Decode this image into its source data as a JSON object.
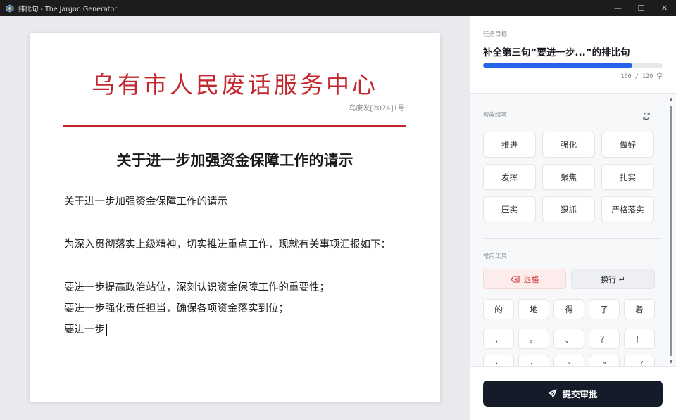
{
  "window": {
    "title": "排比句 - The Jargon Generator",
    "controls": {
      "minimize": "—",
      "maximize": "☐",
      "close": "✕"
    }
  },
  "document": {
    "header": "乌有市人民废话服务中心",
    "doc_number": "乌废发[2024]1号",
    "title": "关于进一步加强资金保障工作的请示",
    "lines": [
      "关于进一步加强资金保障工作的请示",
      "为深入贯彻落实上级精神，切实推进重点工作，现就有关事项汇报如下：",
      "要进一步提高政治站位，深刻认识资金保障工作的重要性；",
      "要进一步强化责任担当，确保各项资金落实到位；",
      "要进一步"
    ]
  },
  "task": {
    "caption": "任务目标",
    "title": "补全第三句“要进一步...”的排比句",
    "progress": {
      "current": 100,
      "max": 120,
      "fraction": 0.8333,
      "label": "100 / 120 字"
    }
  },
  "suggestions": {
    "label": "智能续写",
    "refresh_icon": "refresh-icon",
    "words": [
      "推进",
      "强化",
      "做好",
      "发挥",
      "聚焦",
      "扎实",
      "压实",
      "狠抓",
      "严格落实"
    ]
  },
  "tools": {
    "label": "常用工具",
    "backspace_label": "退格",
    "newline_label": "换行 ↵",
    "row1": [
      "的",
      "地",
      "得",
      "了",
      "着"
    ],
    "row2": [
      "，",
      "。",
      "、",
      "？",
      "！"
    ],
    "row3": [
      "：",
      "；",
      "“",
      "”",
      "（"
    ]
  },
  "submit": {
    "label": "提交审批"
  },
  "colors": {
    "accent": "#2563eb",
    "header_red": "#c2272d",
    "submit_bg": "#161b2a",
    "backspace_bg": "#fdecec"
  }
}
